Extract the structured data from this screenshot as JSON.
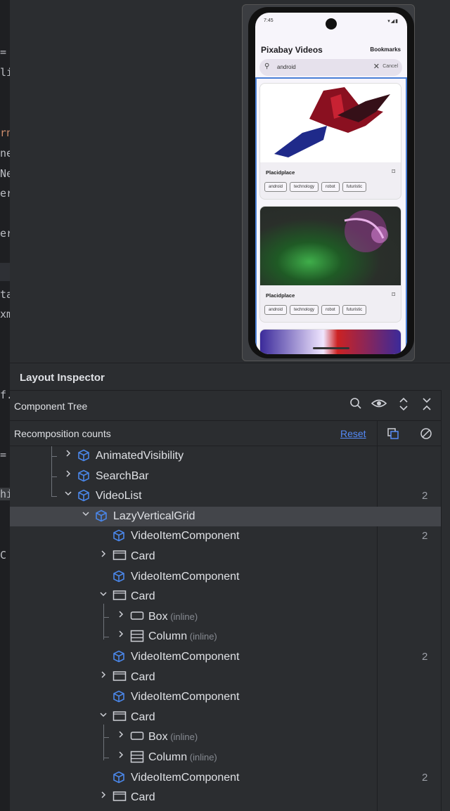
{
  "editor_fragments": [
    "=",
    "li",
    "rn",
    "ne",
    "Ne",
    "er",
    "er",
    "ta",
    "xm",
    "f.",
    "=",
    "hi",
    "C"
  ],
  "emulator": {
    "status_time": "7:45",
    "status_icons": "▾◢▮",
    "app_title": "Pixabay Videos",
    "bookmarks_label": "Bookmarks",
    "search_value": "android",
    "search_cancel": "Cancel",
    "cards": [
      {
        "title": "Placidplace",
        "tags": [
          "android",
          "technology",
          "robot",
          "futuristic"
        ]
      },
      {
        "title": "Placidplace",
        "tags": [
          "android",
          "technology",
          "robot",
          "futuristic"
        ]
      }
    ]
  },
  "inspector": {
    "title": "Layout Inspector",
    "component_tree_title": "Component Tree",
    "recomposition_title": "Recomposition counts",
    "reset_label": "Reset",
    "tree": [
      {
        "label": "AnimatedVisibility",
        "inline": "",
        "icon": "compose-cube-icon",
        "count": ""
      },
      {
        "label": "SearchBar",
        "inline": "",
        "icon": "compose-cube-icon",
        "count": ""
      },
      {
        "label": "VideoList",
        "inline": "",
        "icon": "compose-cube-icon",
        "count": "2"
      },
      {
        "label": "LazyVerticalGrid",
        "inline": "",
        "icon": "compose-cube-icon",
        "count": ""
      },
      {
        "label": "VideoItemComponent",
        "inline": "",
        "icon": "compose-cube-icon",
        "count": "2"
      },
      {
        "label": "Card",
        "inline": "",
        "icon": "card-icon",
        "count": ""
      },
      {
        "label": "VideoItemComponent",
        "inline": "",
        "icon": "compose-cube-icon",
        "count": ""
      },
      {
        "label": "Card",
        "inline": "",
        "icon": "card-icon",
        "count": ""
      },
      {
        "label": "Box",
        "inline": "(inline)",
        "icon": "box-icon",
        "count": ""
      },
      {
        "label": "Column",
        "inline": "(inline)",
        "icon": "column-icon",
        "count": ""
      },
      {
        "label": "VideoItemComponent",
        "inline": "",
        "icon": "compose-cube-icon",
        "count": "2"
      },
      {
        "label": "Card",
        "inline": "",
        "icon": "card-icon",
        "count": ""
      },
      {
        "label": "VideoItemComponent",
        "inline": "",
        "icon": "compose-cube-icon",
        "count": ""
      },
      {
        "label": "Card",
        "inline": "",
        "icon": "card-icon",
        "count": ""
      },
      {
        "label": "Box",
        "inline": "(inline)",
        "icon": "box-icon",
        "count": ""
      },
      {
        "label": "Column",
        "inline": "(inline)",
        "icon": "column-icon",
        "count": ""
      },
      {
        "label": "VideoItemComponent",
        "inline": "",
        "icon": "compose-cube-icon",
        "count": "2"
      },
      {
        "label": "Card",
        "inline": "",
        "icon": "card-icon",
        "count": ""
      }
    ]
  },
  "colors": {
    "accent": "#548af7",
    "selection": "#43454a",
    "panel_bg": "#2b2d30",
    "compose_icon": "#4a86e8"
  }
}
